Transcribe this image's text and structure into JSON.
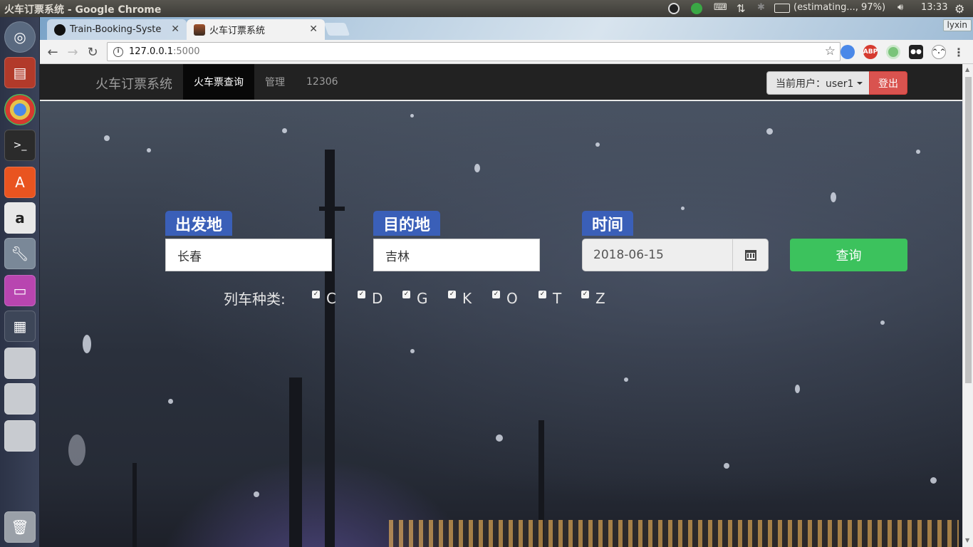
{
  "window": {
    "title": "火车订票系统 - Google Chrome"
  },
  "system_tray": {
    "battery": "(estimating..., 97%)",
    "clock": "13:33"
  },
  "browser": {
    "tabs": [
      {
        "label": "Train-Booking-Syste",
        "icon": "github-icon",
        "active": false
      },
      {
        "label": "火车订票系统",
        "icon": "site-favicon-icon",
        "active": true
      }
    ],
    "profile": "lyxin",
    "url_host": "127.0.0.1",
    "url_port": ":5000",
    "extensions": [
      "shield-extension-icon",
      "abp-extension-icon",
      "green-circle-extension-icon",
      "mask-extension-icon",
      "cat-extension-icon"
    ]
  },
  "navbar": {
    "brand": "火车订票系统",
    "links": [
      {
        "label": "火车票查询",
        "active": true
      },
      {
        "label": "管理",
        "active": false
      },
      {
        "label": "12306",
        "active": false
      }
    ],
    "user_label": "当前用户：user1",
    "logout_label": "登出"
  },
  "form": {
    "from_label": "出发地",
    "from_value": "长春",
    "to_label": "目的地",
    "to_value": "吉林",
    "date_label": "时间",
    "date_value": "2018-06-15",
    "search_label": "查询",
    "train_type_label": "列车种类:",
    "train_types": [
      {
        "label": "C",
        "checked": true
      },
      {
        "label": "D",
        "checked": true
      },
      {
        "label": "G",
        "checked": true
      },
      {
        "label": "K",
        "checked": true
      },
      {
        "label": "O",
        "checked": true
      },
      {
        "label": "T",
        "checked": true
      },
      {
        "label": "Z",
        "checked": true
      }
    ]
  },
  "colors": {
    "label_blue": "#3a5fb8",
    "search_green": "#3cc25d",
    "logout_red": "#d9534f",
    "navbar_bg": "#222222"
  }
}
